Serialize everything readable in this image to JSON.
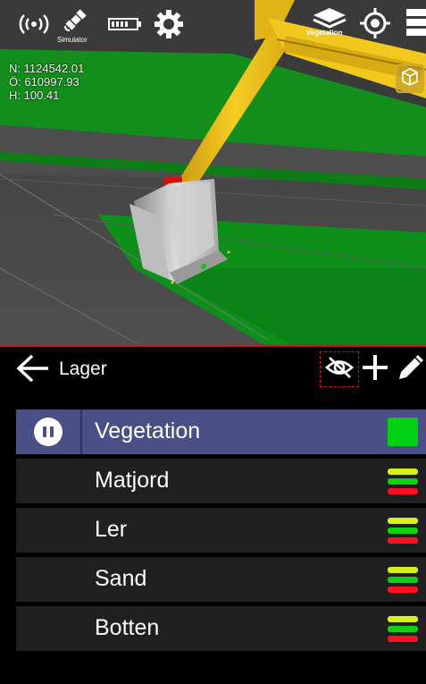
{
  "app": {
    "simulator_label": "Simulator",
    "active_layer_label": "Vegetation"
  },
  "icons": {
    "connection": "wifi-signal-icon",
    "gps": "satellite-icon",
    "battery": "battery-icon",
    "settings": "gear-icon",
    "layers": "layers-icon",
    "locate": "crosshair-icon",
    "menu": "menu-icon",
    "view3d": "cube-icon",
    "back": "arrow-left-icon",
    "hide": "eye-off-icon",
    "add": "plus-icon",
    "edit": "pencil-icon",
    "pause": "pause-icon"
  },
  "coords": {
    "north": "N: 1124542.01",
    "east": "Ö: 610997.93",
    "height": "H: 100.41"
  },
  "panel": {
    "title": "Lager"
  },
  "layers": [
    {
      "name": "Vegetation",
      "active": true,
      "color": "#00d014"
    },
    {
      "name": "Matjord",
      "active": false
    },
    {
      "name": "Ler",
      "active": false
    },
    {
      "name": "Sand",
      "active": false
    },
    {
      "name": "Botten",
      "active": false
    }
  ],
  "colors": {
    "accent_active_row": "#4a4f85",
    "row_background": "#202020",
    "divider_red": "#c0151a",
    "level_yellow": "#d6f01a",
    "level_green": "#10d010",
    "level_red": "#ff1020",
    "boom_yellow": "#f0c419"
  }
}
